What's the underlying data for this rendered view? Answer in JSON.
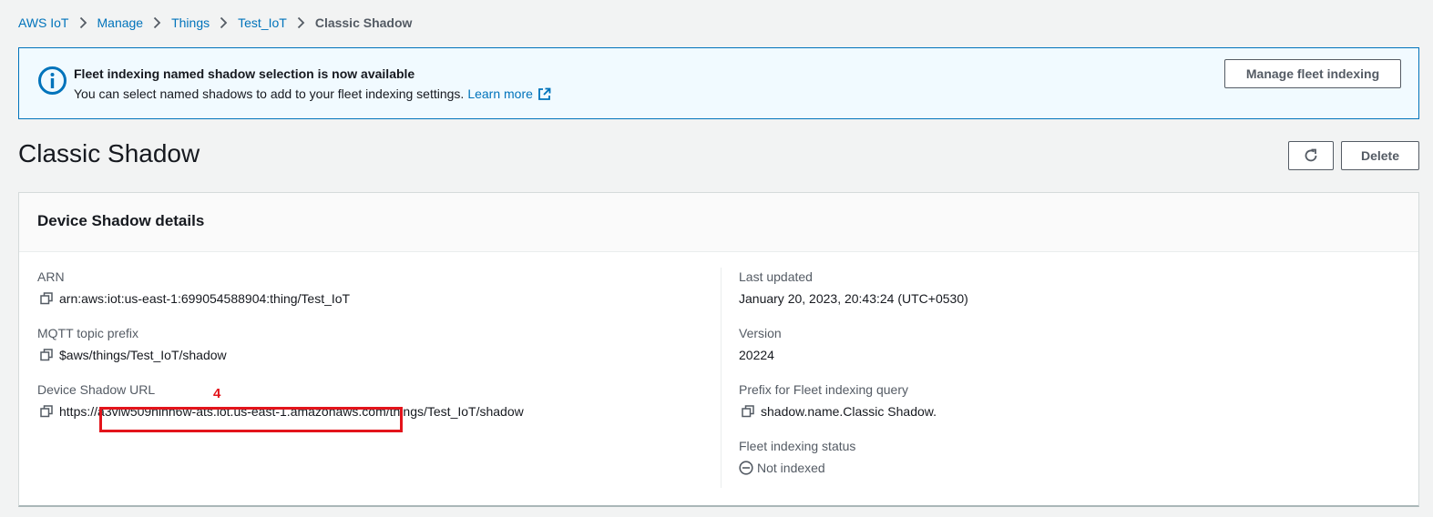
{
  "breadcrumb": {
    "items": [
      "AWS IoT",
      "Manage",
      "Things",
      "Test_IoT"
    ],
    "current": "Classic Shadow"
  },
  "flash": {
    "icon": "info-icon",
    "title": "Fleet indexing named shadow selection is now available",
    "body": "You can select named shadows to add to your fleet indexing settings.",
    "link": "Learn more",
    "button": "Manage fleet indexing"
  },
  "page": {
    "title": "Classic Shadow",
    "delete_label": "Delete"
  },
  "details": {
    "header": "Device Shadow details",
    "left": {
      "arn_key": "ARN",
      "arn_val": "arn:aws:iot:us-east-1:699054588904:thing/Test_IoT",
      "mqtt_key": "MQTT topic prefix",
      "mqtt_val": "$aws/things/Test_IoT/shadow",
      "url_key": "Device Shadow URL",
      "url_prefix": "https://",
      "url_host": "a3vlw509hinh6w-ats.iot.us-east-1.amazonaws.com",
      "url_path": "/things/Test_IoT/shadow"
    },
    "right": {
      "updated_key": "Last updated",
      "updated_val": "January 20, 2023, 20:43:24 (UTC+0530)",
      "version_key": "Version",
      "version_val": "20224",
      "prefix_key": "Prefix for Fleet indexing query",
      "prefix_val": "shadow.name.Classic Shadow.",
      "status_key": "Fleet indexing status",
      "status_val": "Not indexed"
    }
  },
  "annotation": {
    "label": "4",
    "color": "#e3141b"
  },
  "colors": {
    "link": "#0073bb",
    "info_border": "#0073bb",
    "info_bg": "#f1faff"
  }
}
